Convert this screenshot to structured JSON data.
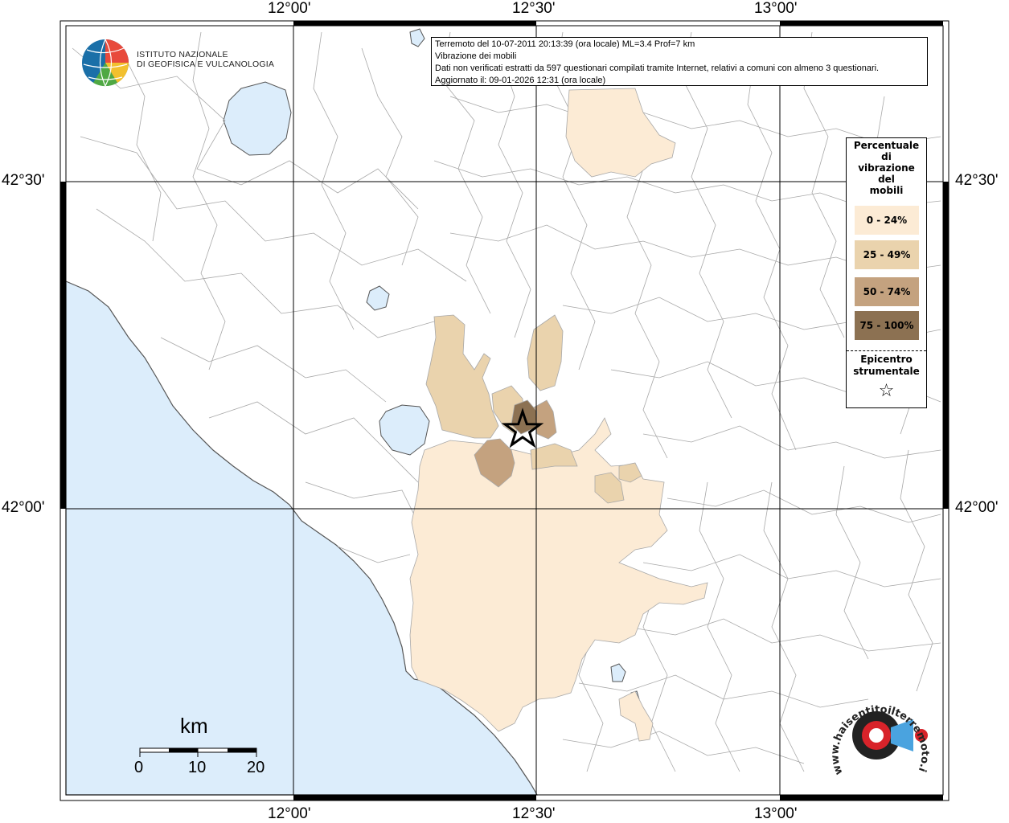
{
  "map_frame": {
    "lon_labels": [
      "12°00'",
      "12°30'",
      "13°00'"
    ],
    "lat_labels": [
      "42°30'",
      "42°00'"
    ]
  },
  "info_box": {
    "line1": "Terremoto del 10-07-2011 20:13:39 (ora locale) ML=3.4 Prof=7 km",
    "line2": "Vibrazione dei mobili",
    "line3": "Dati non verificati estratti da 597 questionari compilati tramite Internet, relativi a comuni con almeno 3 questionari.",
    "line4": "Aggiornato il: 09-01-2026 12:31 (ora locale)"
  },
  "logo": {
    "line1": "ISTITUTO NAZIONALE",
    "line2": "DI GEOFISICA E VULCANOLOGIA"
  },
  "legend": {
    "title_lines": [
      "Percentuale",
      "di",
      "vibrazione",
      "del",
      "mobili"
    ],
    "classes": [
      {
        "label": "0 - 24%",
        "color": "#fcebd5"
      },
      {
        "label": "25 - 49%",
        "color": "#ead3ad"
      },
      {
        "label": "50 - 74%",
        "color": "#c4a27f"
      },
      {
        "label": "75 - 100%",
        "color": "#8c7152"
      }
    ],
    "epicenter_lines": [
      "Epicentro",
      "strumentale"
    ],
    "epicenter_symbol": "☆"
  },
  "scale_bar": {
    "unit": "km",
    "ticks": [
      "0",
      "10",
      "20"
    ]
  },
  "colors": {
    "sea": "#dcedfb",
    "boundary": "#a8a8a8",
    "grid": "#000000"
  },
  "watermark": {
    "text": "www.haisentitoilterremoto.it"
  }
}
